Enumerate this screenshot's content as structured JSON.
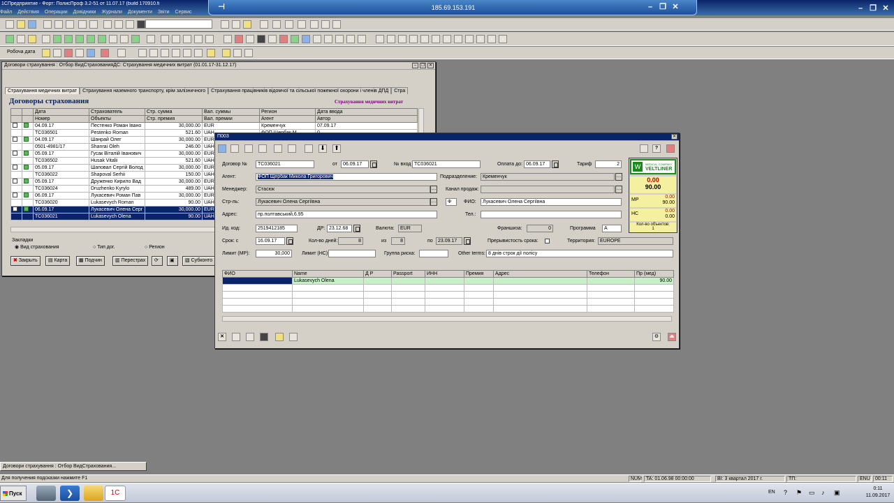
{
  "app": {
    "title": "1СПредприятие - Форт: ПолисПроф 3.2-51 от 11.07.17 (build 170910.fi",
    "menu": [
      "Файл",
      "Действия",
      "Операции",
      "Довідники",
      "Журнали",
      "Документи",
      "Звіти",
      "Сервис"
    ]
  },
  "rdp": {
    "host": "185.69.153.191"
  },
  "toolbar": {
    "work_date_label": "Робоча дата"
  },
  "list_window": {
    "title": "Договори страхування : Отбор ВидСтрахованияДС: Страхування медичних витрат (01.01.17-31.12.17)",
    "tabs": [
      "Страхування медичних витрат",
      "Страхування наземного транспорту, крім залізничного",
      "Страхування працівників відомчої та сільської пожежної охорони і членів ДПД",
      "Стра"
    ],
    "heading": "Договоры страхования",
    "subheading": "Страхування медичних витрат",
    "columns_top": [
      "Дата",
      "Страхователь",
      "Стр. сумма",
      "Вал. суммы",
      "Регион",
      "Дата ввода"
    ],
    "columns_bottom": [
      "Номер",
      "Объекты",
      "Стр. премия",
      "Вал. премии",
      "Агент",
      "Автор"
    ],
    "rows": [
      {
        "date": "04.09.17",
        "num": "TC036501",
        "insurer": "Пестенко Роман Івано",
        "object": "Pestenko Roman",
        "sum": "30,000.00",
        "prem": "521.60",
        "cur1": "EUR",
        "cur2": "UAH",
        "region": "Кременчук",
        "agent": "ФОП Щербак М",
        "created": "07.09.17",
        "author": "0"
      },
      {
        "date": "04.09.17",
        "num": "0501-4981/17",
        "insurer": "Шанрай Олег",
        "object": "Shanrai Oleh",
        "sum": "30,000.00",
        "prem": "246.00",
        "cur1": "EUR",
        "cur2": "UAH",
        "region": "",
        "agent": "",
        "created": "",
        "author": ""
      },
      {
        "date": "05.09.17",
        "num": "TC036502",
        "insurer": "Гусак Віталій Іванович",
        "object": "Husak Vitalii",
        "sum": "30,000.00",
        "prem": "521.60",
        "cur1": "EUR",
        "cur2": "UAH",
        "region": "",
        "agent": "",
        "created": "",
        "author": ""
      },
      {
        "date": "05.09.17",
        "num": "TC036022",
        "insurer": "Шаповал Сергій Волод",
        "object": "Shapoval Serhii",
        "sum": "30,000.00",
        "prem": "150.00",
        "cur1": "EUR",
        "cur2": "UAH",
        "region": "",
        "agent": "",
        "created": "",
        "author": ""
      },
      {
        "date": "05.09.17",
        "num": "TC036024",
        "insurer": "Друженко Кирило Вад",
        "object": "Druzhenko Kyrylo",
        "sum": "30,000.00",
        "prem": "489.00",
        "cur1": "EUR",
        "cur2": "UAH",
        "region": "",
        "agent": "",
        "created": "",
        "author": ""
      },
      {
        "date": "06.09.17",
        "num": "TC036020",
        "insurer": "Лукасевич Роман Пав",
        "object": "Lukasevych Roman",
        "sum": "30,000.00",
        "prem": "90.00",
        "cur1": "EUR",
        "cur2": "UAH",
        "region": "",
        "agent": "",
        "created": "",
        "author": ""
      },
      {
        "date": "06.09.17",
        "num": "TC036021",
        "insurer": "Лукасевич Олена Серг",
        "object": "Lukasevych Olena",
        "sum": "30,000.00",
        "prem": "90.00",
        "cur1": "EUR",
        "cur2": "UAH",
        "region": "",
        "agent": "",
        "created": "",
        "author": ""
      }
    ],
    "bookmarks": {
      "label": "Закладки",
      "options": [
        "Вид страхования",
        "Тип дог.",
        "Регион"
      ]
    },
    "buttons": [
      "Закрыть",
      "Карта",
      "Подчин",
      "Перестрах",
      "",
      "Субконто"
    ]
  },
  "form": {
    "title": "П003",
    "labels": {
      "contract": "Договор №",
      "from": "от",
      "in_num": "№ вход",
      "pay_to": "Оплата до:",
      "tariff": "Тариф",
      "agent": "Агент:",
      "division": "Подразделение:",
      "manager": "Менеджер:",
      "channel": "Канал продаж:",
      "insurer": "Стр-ль:",
      "fio": "ФИО:",
      "address": "Адрес:",
      "phone": "Тел.:",
      "id_code": "Ид. код:",
      "dob": "ДР:",
      "currency": "Валюта:",
      "franchise": "Франшиза:",
      "program": "Программа",
      "term_from": "Срок: с",
      "days": "Кол-во дней:",
      "of": "из",
      "to": "по",
      "interrupted": "Прерывистость срока:",
      "territory": "Территория:",
      "limit_mr": "Лимит (МР):",
      "limit_ns": "Лимит (НС):",
      "risk_group": "Группа риска:",
      "other_terms": "Other terms:"
    },
    "values": {
      "contract": "TC036021",
      "from": "06.09.17",
      "in_num": "TC036021",
      "pay_to": "06.09.17",
      "tariff": "2",
      "agent": "ФОП Щербак Микола Григорович",
      "division": "Кременчук",
      "manager": "Стасюк",
      "channel": "",
      "insurer": "Лукасевич Олена Сергіївна",
      "fio_prefix": "Ф",
      "fio": "Лукасевич Олена Сергіївна",
      "address": "пр.полтавський,6.95",
      "phone": "",
      "id_code": "2519412185",
      "dob": "23.12.68",
      "currency": "EUR",
      "franchise": "0",
      "program": "A",
      "term_from": "16.09.17",
      "days": "8",
      "of": "8",
      "to": "23.09.17",
      "territory": "EUROPE",
      "limit_mr": "30,000",
      "limit_ns": "",
      "risk_group": "",
      "other_terms": "8 днів строк дії полісу"
    },
    "panel": {
      "brand": "VELTLINER",
      "brand_sub": "MEDICAL COMPANY",
      "total1": "0.00",
      "total2": "90.00",
      "mr_label": "МР",
      "mr1": "0.00",
      "mr2": "90.00",
      "ns_label": "НС",
      "ns1": "0.00",
      "ns2": "0.00",
      "objects_label": "Кол-во объектов:",
      "objects": "1"
    },
    "table": {
      "columns": [
        "ФИО",
        "Name",
        "Д Р",
        "Passport",
        "ИНН",
        "Премия",
        "Адрес",
        "Телефон",
        "Пр (мед)"
      ],
      "rows": [
        [
          "",
          "Lukasevych Olena",
          "",
          "",
          "",
          "",
          "",
          "",
          "90.00"
        ]
      ]
    }
  },
  "taskbar": {
    "window_item": "Договори страхування : Отбор ВидСтрахования..."
  },
  "status": {
    "hint": "Для получения подсказки нажмите F1",
    "num": "NUM",
    "ta": "TA: 01.06.98 00:00:00",
    "bi": "BI: 3 квартал 2017 г.",
    "tp": "TП:",
    "lang_code": "ENU",
    "counter": "00:11"
  },
  "wintaskbar": {
    "start": "Пуск",
    "lang": "EN",
    "time": "0:11",
    "date": "11.09.2017"
  }
}
